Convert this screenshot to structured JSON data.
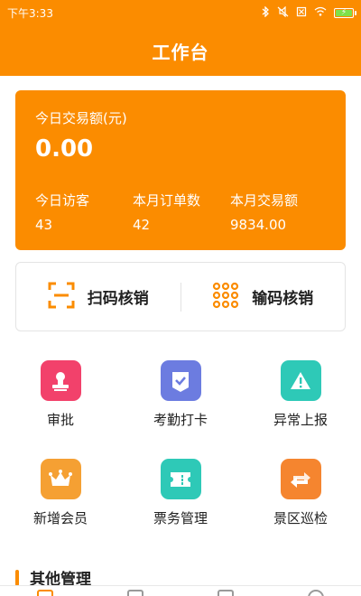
{
  "status_bar": {
    "time": "下午3:33"
  },
  "header": {
    "title": "工作台"
  },
  "stats": {
    "label": "今日交易额(元)",
    "amount": "0.00",
    "items": [
      {
        "label": "今日访客",
        "value": "43"
      },
      {
        "label": "本月订单数",
        "value": "42"
      },
      {
        "label": "本月交易额",
        "value": "9834.00"
      }
    ]
  },
  "verify": {
    "scan_label": "扫码核销",
    "code_label": "输码核销"
  },
  "grid": {
    "items": [
      {
        "label": "审批",
        "icon": "stamp-icon",
        "color": "#f2416b"
      },
      {
        "label": "考勤打卡",
        "icon": "checkin-icon",
        "color": "#6c7ce0"
      },
      {
        "label": "异常上报",
        "icon": "warning-icon",
        "color": "#2ec9b7"
      },
      {
        "label": "新增会员",
        "icon": "crown-icon",
        "color": "#f5a033"
      },
      {
        "label": "票务管理",
        "icon": "ticket-icon",
        "color": "#2ec9b7"
      },
      {
        "label": "景区巡检",
        "icon": "exchange-icon",
        "color": "#f5852f"
      }
    ]
  },
  "section": {
    "title": "其他管理"
  },
  "colors": {
    "brand": "#fb8c00"
  }
}
